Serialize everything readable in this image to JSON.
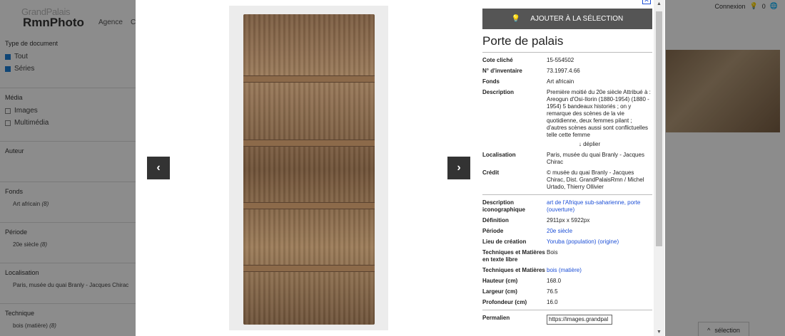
{
  "bg": {
    "logo_line1": "GrandPalais",
    "logo_line2": "RmnPhoto",
    "nav_agence": "Agence",
    "nav_cut": "C",
    "login": "Connexion",
    "cart_count": "0",
    "selection_label": "sélection",
    "filters": [
      {
        "title": "Type de document",
        "options": [
          {
            "label": "Tout",
            "checked": true
          },
          {
            "label": "Séries",
            "checked": true
          }
        ]
      },
      {
        "title": "Média",
        "options": [
          {
            "label": "Images",
            "checked": false
          },
          {
            "label": "Multimédia",
            "checked": false
          }
        ]
      },
      {
        "title": "Auteur"
      },
      {
        "title": "Fonds",
        "facet": "Art africain",
        "count": "(8)"
      },
      {
        "title": "Période",
        "facet": "20e siècle",
        "count": "(8)"
      },
      {
        "title": "Localisation",
        "facet": "Paris, musée du quai Branly - Jacques Chirac"
      },
      {
        "title": "Technique",
        "facet": "bois (matière)",
        "count": "(8)"
      }
    ]
  },
  "modal": {
    "add_label": "AJOUTER À LA SÉLECTION",
    "title": "Porte de palais",
    "unfold": "↓ déplier",
    "meta1": [
      {
        "k": "Cote cliché",
        "v": "15-554502"
      },
      {
        "k": "N° d'inventaire",
        "v": "73.1997.4.66"
      },
      {
        "k": "Fonds",
        "v": "Art africain"
      },
      {
        "k": "Description",
        "v": "Première moitié du 20e siècle Attribué à : Areogun d'Osi-Ilorin (1880-1954) (1880 - 1954) 5 bandeaux historiés ; on y remarque des scènes de la vie quotidienne, deux femmes pilant ; d'autres scènes aussi sont conflictuelles telle cette femme"
      }
    ],
    "meta2": [
      {
        "k": "Localisation",
        "v": "Paris, musée du quai Branly - Jacques Chirac"
      },
      {
        "k": "Crédit",
        "v": "© musée du quai Branly - Jacques Chirac, Dist. GrandPalaisRmn / Michel Urtado, Thierry Ollivier"
      }
    ],
    "meta3": [
      {
        "k": "Description iconographique",
        "v": "art de l'Afrique sub-saharienne, porte (ouverture)",
        "link": true
      },
      {
        "k": "Définition",
        "v": "2911px x 5922px"
      },
      {
        "k": "Période",
        "v": "20e siècle",
        "link": true
      },
      {
        "k": "Lieu de création",
        "v": "Yoruba (population) (origine)",
        "link": true
      },
      {
        "k": "Techniques et Matières en texte libre",
        "v": "Bois"
      },
      {
        "k": "Techniques et Matières",
        "v": "bois (matière)",
        "link": true
      },
      {
        "k": "Hauteur (cm)",
        "v": "168.0"
      },
      {
        "k": "Largeur (cm)",
        "v": "76.5"
      },
      {
        "k": "Profondeur (cm)",
        "v": "16.0"
      }
    ],
    "permalien_label": "Permalien",
    "permalien_value": "https://images.grandpal"
  }
}
